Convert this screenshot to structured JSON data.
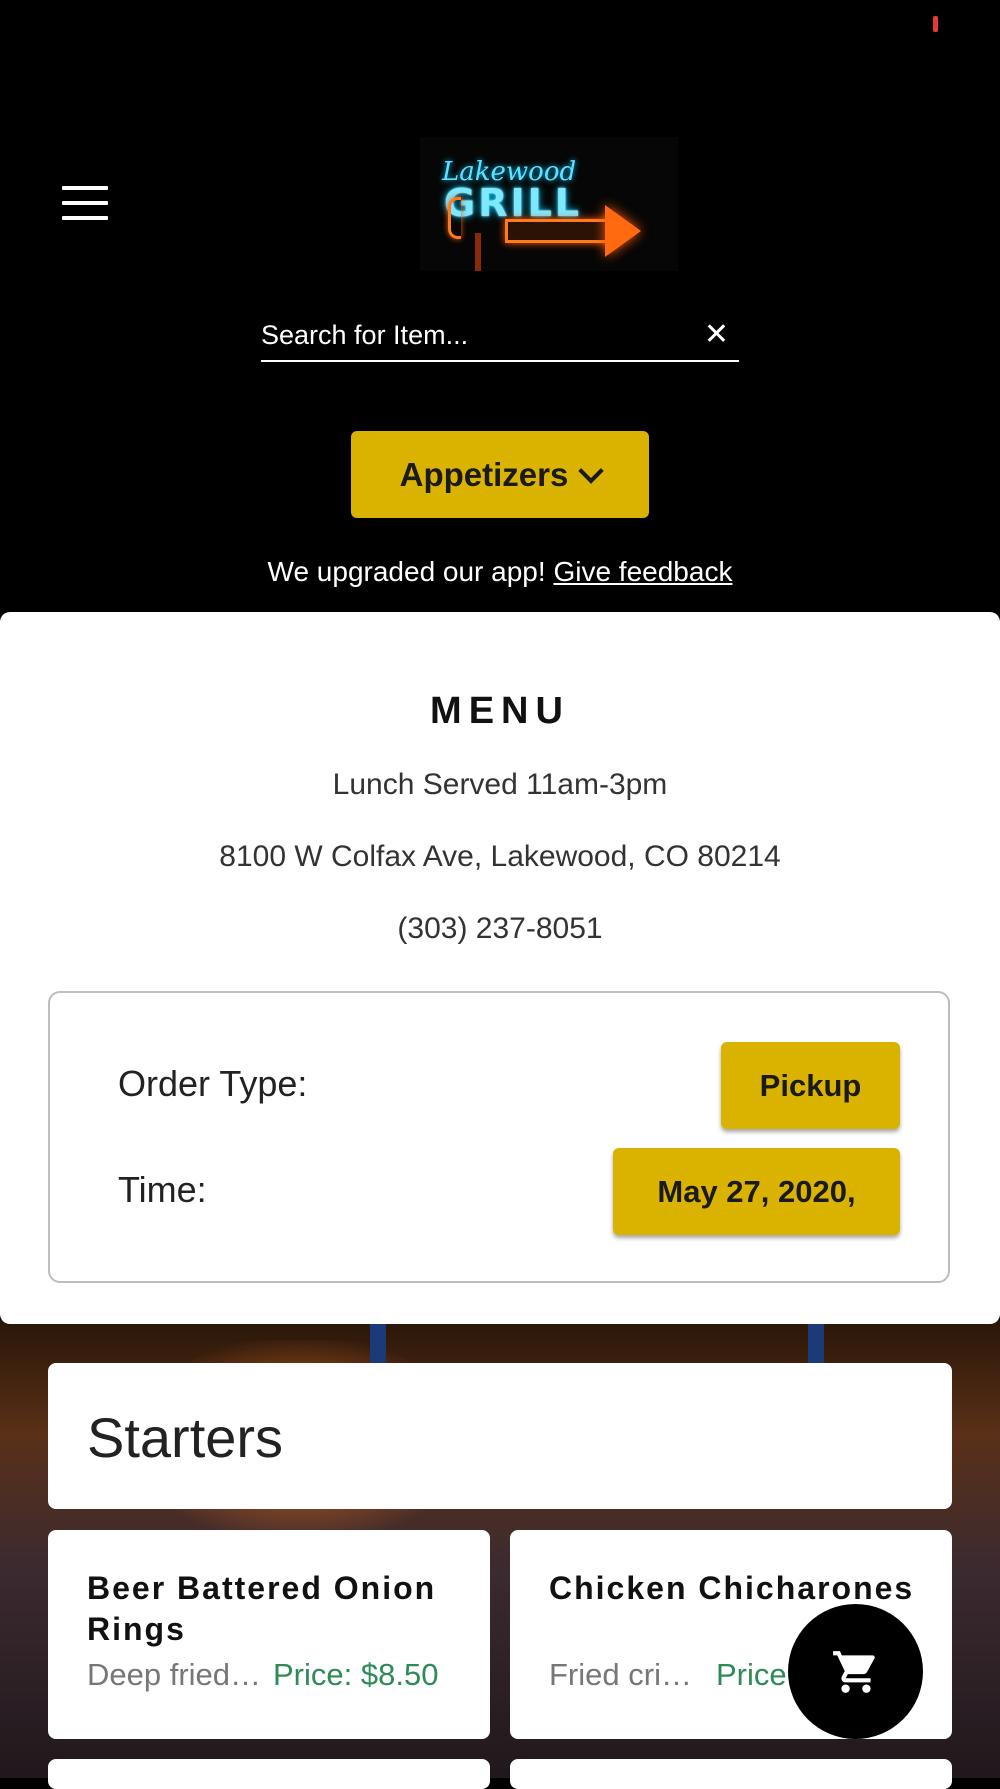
{
  "header": {
    "logo_text_script": "Lakewood",
    "logo_text_main": "GRILL",
    "search": {
      "placeholder": "Search for Item...",
      "value": ""
    },
    "category_button": "Appetizers",
    "upgrade_message": "We upgraded our app!",
    "feedback_link": "Give feedback"
  },
  "menu": {
    "title": "MENU",
    "hours": "Lunch Served 11am-3pm",
    "address": "8100 W Colfax Ave, Lakewood, CO 80214",
    "phone": "(303) 237-8051"
  },
  "order": {
    "type_label": "Order Type:",
    "type_value": "Pickup",
    "time_label": "Time:",
    "time_value": "May 27, 2020,"
  },
  "section": {
    "title": "Starters"
  },
  "items": [
    {
      "name": "Beer Battered Onion Rings",
      "description": "Deep fried onion rings",
      "price": "Price: $8.50"
    },
    {
      "name": "Chicken Chicharones",
      "description": "Fried crispy chicken",
      "price": "Price:"
    }
  ],
  "colors": {
    "accent": "#d9b300",
    "price": "#2e8b57",
    "background": "#000000",
    "card": "#ffffff"
  },
  "icons": {
    "menu": "hamburger-menu-icon",
    "clear": "close-icon",
    "dropdown": "chevron-down-icon",
    "cart": "shopping-cart-icon"
  }
}
